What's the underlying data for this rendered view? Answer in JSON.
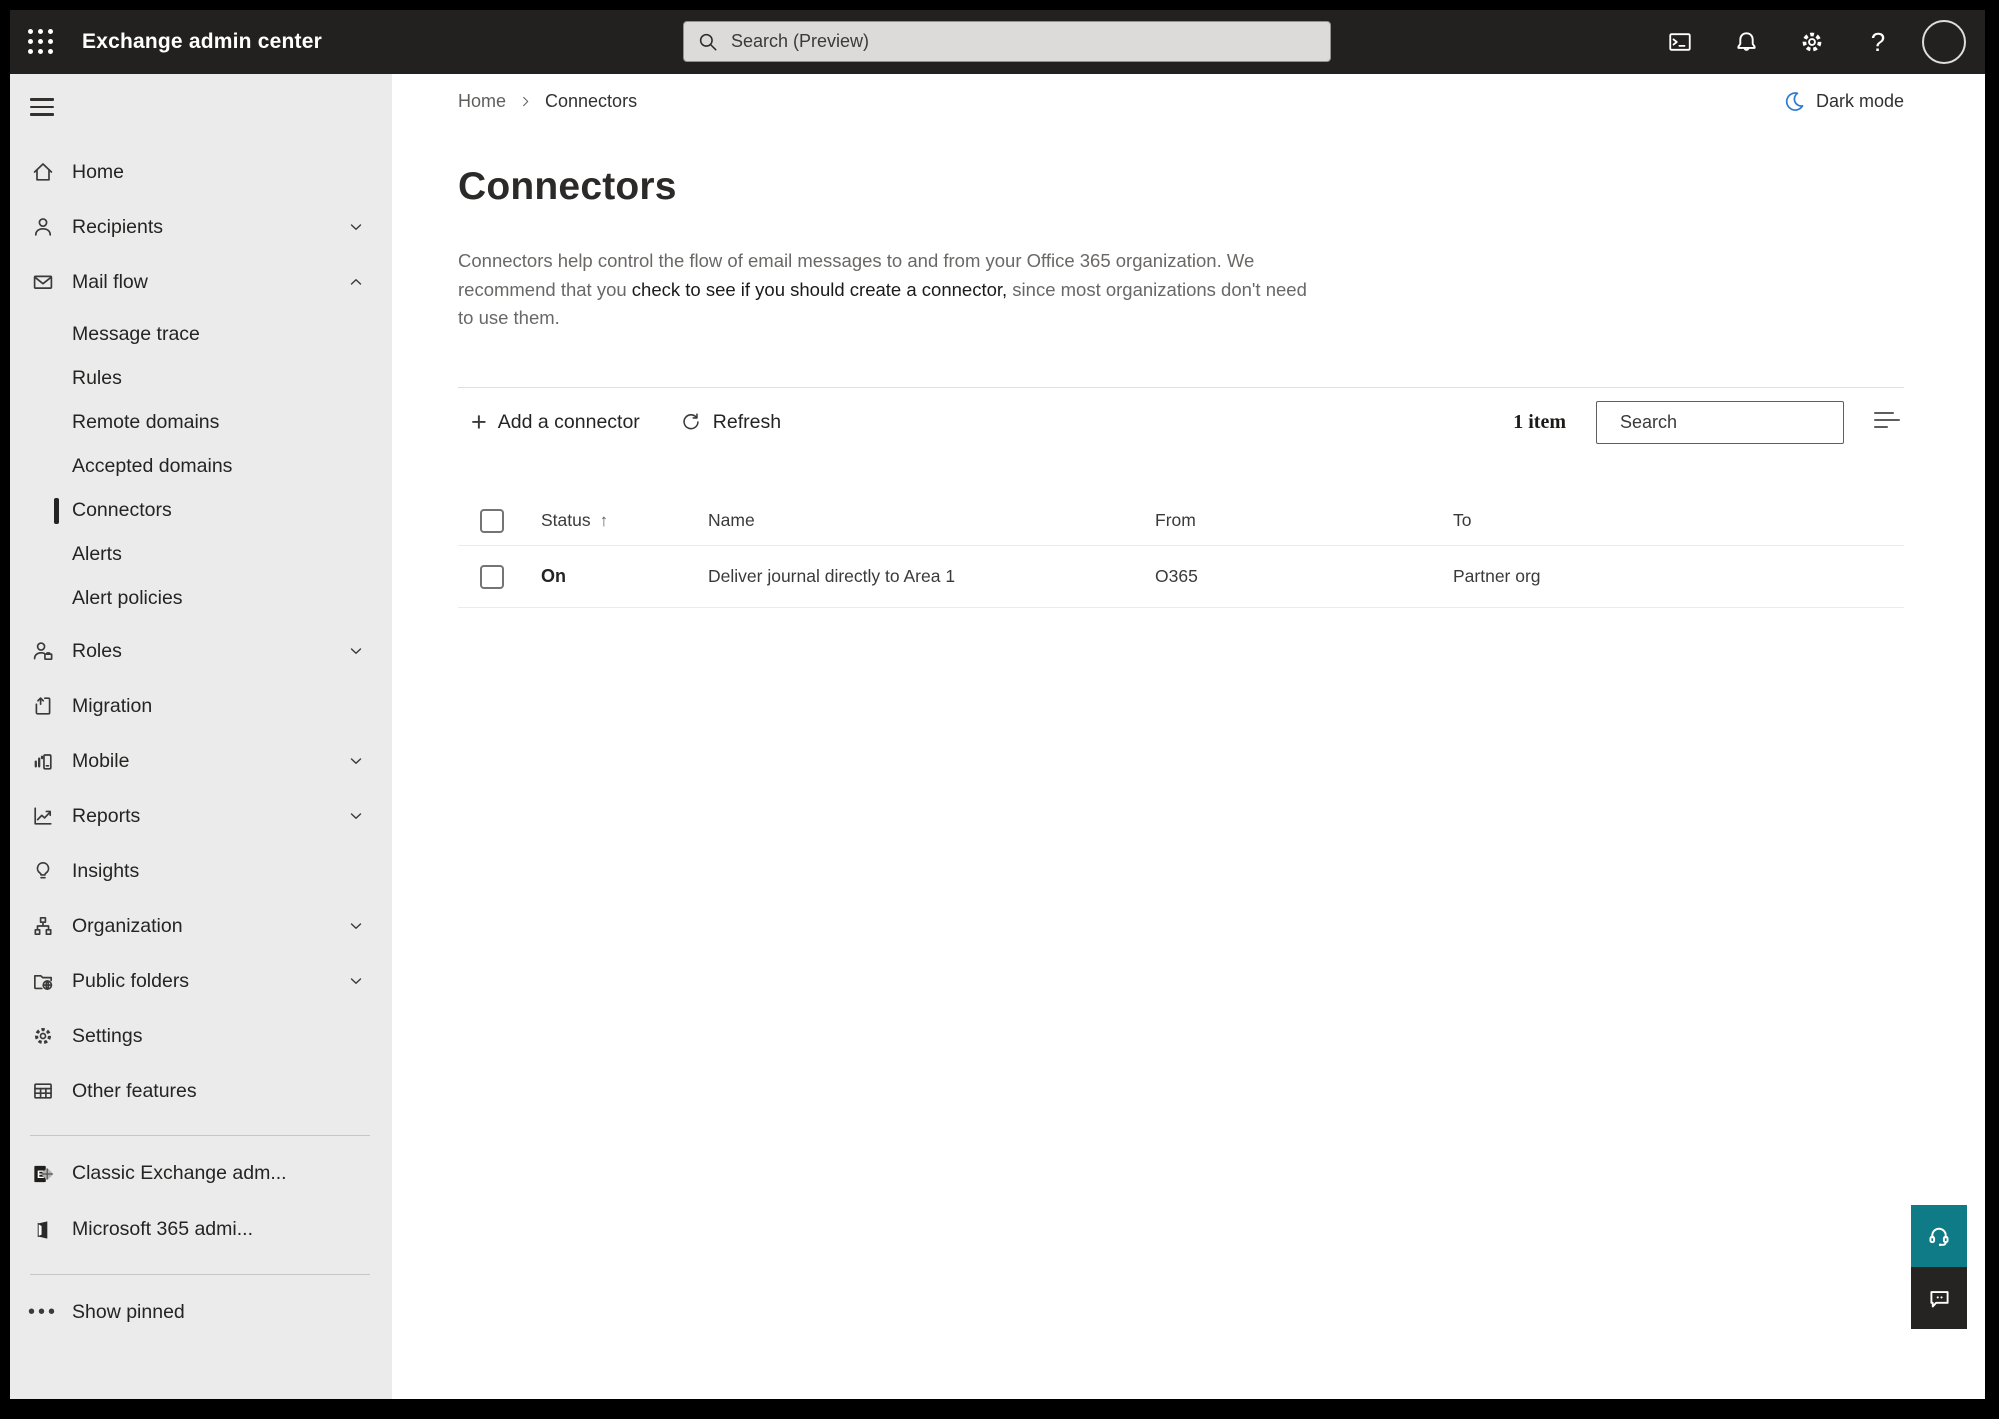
{
  "topbar": {
    "app_title": "Exchange admin center",
    "search_placeholder": "Search (Preview)",
    "help_glyph": "?"
  },
  "sidebar": {
    "items": [
      {
        "label": "Home",
        "icon": "home-icon"
      },
      {
        "label": "Recipients",
        "icon": "person-icon",
        "expandable": true
      },
      {
        "label": "Mail flow",
        "icon": "mail-icon",
        "expandable": true,
        "expanded": true
      },
      {
        "label": "Roles",
        "icon": "person-badge-icon",
        "expandable": true
      },
      {
        "label": "Migration",
        "icon": "document-arrow-icon"
      },
      {
        "label": "Mobile",
        "icon": "mobile-chart-icon",
        "expandable": true
      },
      {
        "label": "Reports",
        "icon": "line-chart-icon",
        "expandable": true
      },
      {
        "label": "Insights",
        "icon": "lightbulb-icon"
      },
      {
        "label": "Organization",
        "icon": "org-chart-icon",
        "expandable": true
      },
      {
        "label": "Public folders",
        "icon": "folder-globe-icon",
        "expandable": true
      },
      {
        "label": "Settings",
        "icon": "gear-icon"
      },
      {
        "label": "Other features",
        "icon": "table-icon"
      }
    ],
    "mailflow_children": [
      "Message trace",
      "Rules",
      "Remote domains",
      "Accepted domains",
      "Connectors",
      "Alerts",
      "Alert policies"
    ],
    "selected_item": "Connectors",
    "footer_items": [
      "Classic Exchange adm...",
      "Microsoft 365 admi..."
    ],
    "show_pinned": "Show pinned"
  },
  "main": {
    "breadcrumb": [
      "Home",
      "Connectors"
    ],
    "dark_mode": "Dark mode",
    "title": "Connectors",
    "description": {
      "before": "Connectors help control the flow of email messages to and from your Office 365 organization. We recommend that you ",
      "link": "check to see if you should create a connector,",
      "after": " since most organizations don't need to use them."
    }
  },
  "toolbar": {
    "add": "Add a connector",
    "refresh": "Refresh",
    "count": "1 item",
    "search_placeholder": "Search"
  },
  "table": {
    "headers": {
      "status": "Status",
      "name": "Name",
      "from": "From",
      "to": "To"
    },
    "sort_column": "Status",
    "sort_direction": "ascending",
    "rows": [
      {
        "status": "On",
        "name": "Deliver journal directly to Area 1",
        "from": "O365",
        "to": "Partner org"
      }
    ]
  },
  "colors": {
    "topbar_bg": "#222120",
    "sidebar_bg": "#EBEBEB",
    "moon_blue": "#2E7CD6",
    "help_button_teal": "#0F7B87",
    "feedback_button_dark": "#252423"
  }
}
